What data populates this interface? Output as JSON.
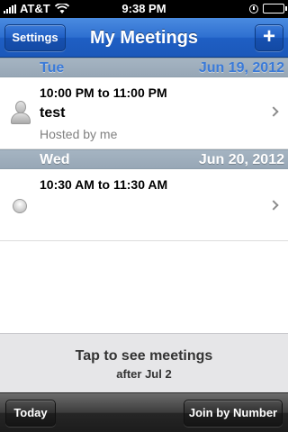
{
  "status_bar": {
    "carrier": "AT&T",
    "time": "9:38 PM",
    "battery_level": 0.9
  },
  "nav": {
    "title": "My Meetings",
    "settings_label": "Settings",
    "add_label": "+"
  },
  "sections": [
    {
      "day": "Tue",
      "date": "Jun 19, 2012",
      "meetings": [
        {
          "time": "10:00 PM to 11:00 PM",
          "title": "test",
          "host": "Hosted by me",
          "icon": "person-icon"
        }
      ]
    },
    {
      "day": "Wed",
      "date": "Jun 20, 2012",
      "meetings": [
        {
          "time": "10:30 AM to 11:30 AM",
          "title": "",
          "host": "",
          "icon": "status-dot-icon"
        }
      ]
    }
  ],
  "footer": {
    "line1": "Tap to see meetings",
    "line2": "after Jul 2"
  },
  "toolbar": {
    "today_label": "Today",
    "join_label": "Join by Number"
  },
  "colors": {
    "nav_blue": "#2e6fd0",
    "section_header": "#9aabb9",
    "toolbar_dark": "#262626"
  }
}
